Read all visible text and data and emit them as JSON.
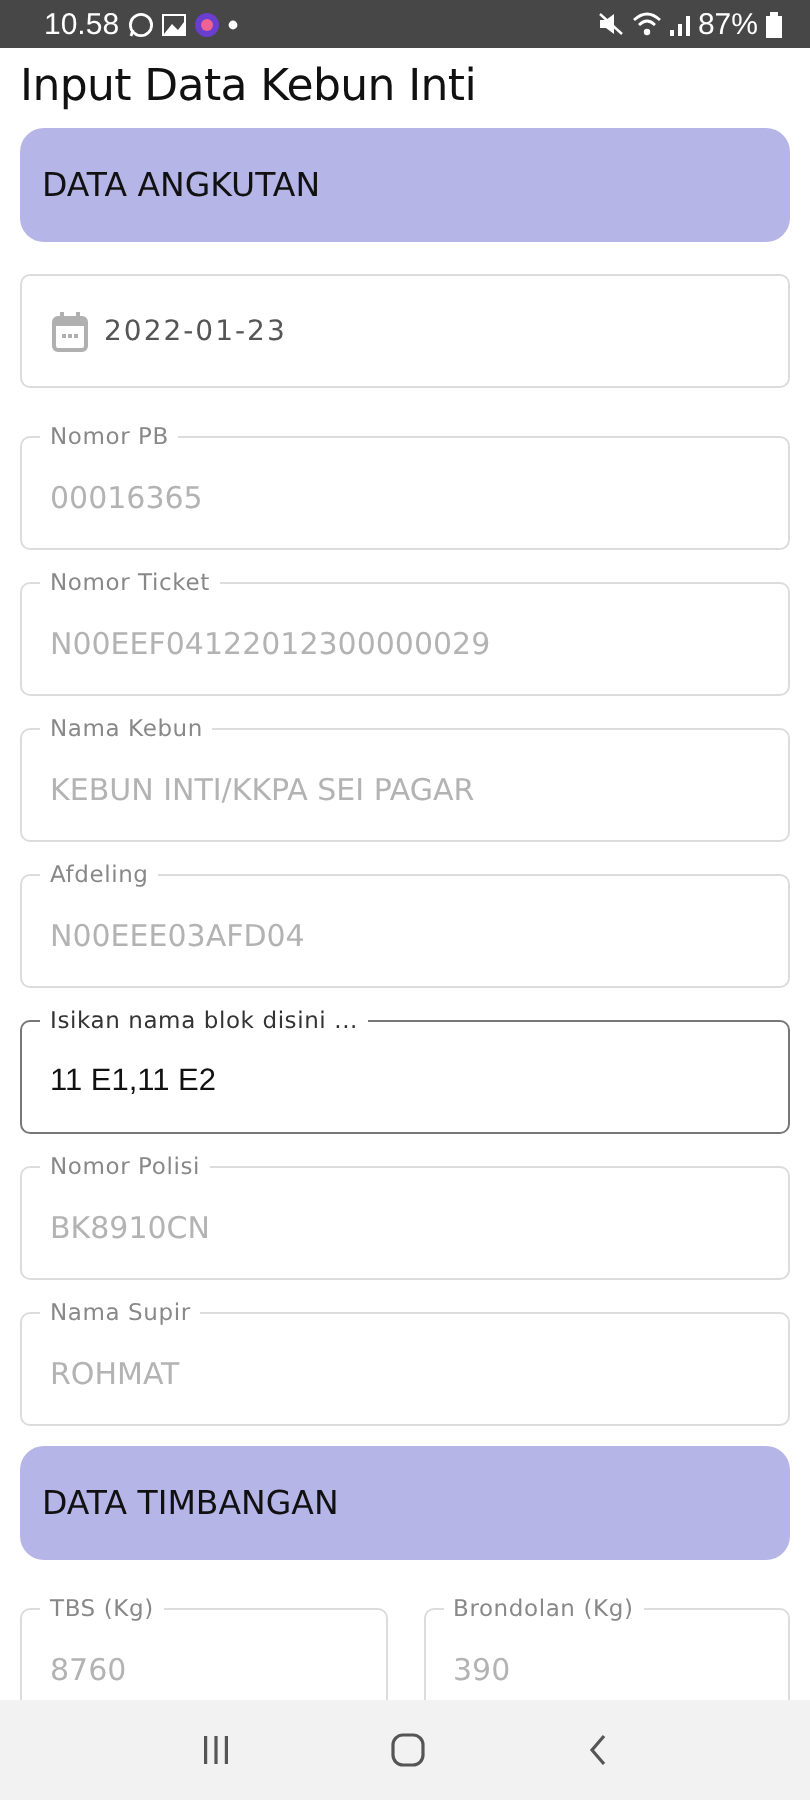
{
  "status_bar": {
    "time": "10.58",
    "battery": "87%"
  },
  "title": "Input Data Kebun Inti",
  "sections": [
    {
      "heading": "DATA ANGKUTAN",
      "fields": [
        {
          "kind": "date",
          "value": "2022-01-23",
          "disabled": true
        },
        {
          "kind": "text",
          "label": "Nomor PB",
          "value": "00016365",
          "disabled": true
        },
        {
          "kind": "text",
          "label": "Nomor Ticket",
          "value": "N00EEF04122012300000029",
          "disabled": true
        },
        {
          "kind": "text",
          "label": "Nama Kebun",
          "value": "KEBUN INTI/KKPA SEI PAGAR",
          "disabled": true
        },
        {
          "kind": "text",
          "label": "Afdeling",
          "value": "N00EEE03AFD04",
          "disabled": true
        },
        {
          "kind": "text",
          "label": "Isikan nama blok disini ...",
          "value": "11 E1,11 E2",
          "disabled": false
        },
        {
          "kind": "text",
          "label": "Nomor Polisi",
          "value": "BK8910CN",
          "disabled": true
        },
        {
          "kind": "text",
          "label": "Nama Supir",
          "value": "ROHMAT",
          "disabled": true
        }
      ]
    },
    {
      "heading": "DATA TIMBANGAN",
      "fields": [
        {
          "kind": "number",
          "label": "TBS (Kg)",
          "value": "8760",
          "disabled": true
        },
        {
          "kind": "number",
          "label": "Brondolan (Kg)",
          "value": "390",
          "disabled": true
        }
      ]
    }
  ]
}
